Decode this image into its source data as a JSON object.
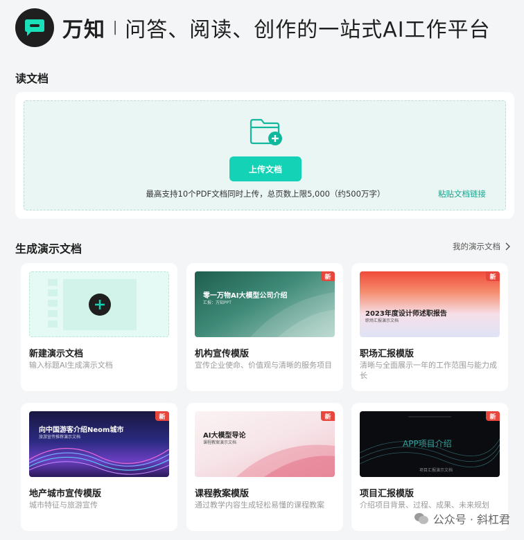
{
  "header": {
    "brand": "万知",
    "separator": "I",
    "slogan": "问答、阅读、创作的一站式AI工作平台"
  },
  "read_section": {
    "title": "读文档",
    "upload_button": "上传文档",
    "hint": "最高支持10个PDF文档同时上传，总页数上限5,000（约500万字）",
    "paste_link": "粘贴文档链接"
  },
  "present_section": {
    "title": "生成演示文档",
    "my_docs_link": "我的演示文档",
    "cards": [
      {
        "title": "新建演示文档",
        "desc": "输入标题AI生成演示文档"
      },
      {
        "title": "机构宣传模版",
        "desc": "宣传企业使命、价值观与清晰的服务项目",
        "badge": "新",
        "thumb_title": "零一万物AI大模型公司介绍",
        "thumb_sub": "汇报：万知PPT"
      },
      {
        "title": "职场汇报模版",
        "desc": "清晰与全面展示一年的工作范围与能力成长",
        "badge": "新",
        "thumb_title": "2023年度设计师述职报告",
        "thumb_sub": "职场汇报演示文档"
      },
      {
        "title": "地产城市宣传模版",
        "desc": "城市特征与旅游宣传",
        "badge": "新",
        "thumb_title": "向中国游客介绍Neom城市",
        "thumb_sub": "旅游宣传推荐演示文档"
      },
      {
        "title": "课程教案模版",
        "desc": "通过教学内容生成轻松易懂的课程教案",
        "badge": "新",
        "thumb_title": "AI大模型导论",
        "thumb_sub": "课程教案演示文档"
      },
      {
        "title": "项目汇报模版",
        "desc": "介绍项目背景、过程、成果、未来规划",
        "badge": "新",
        "thumb_title": "APP项目介绍",
        "thumb_sub": "项目汇报演示文档"
      }
    ]
  },
  "watermark": {
    "text": "公众号 · 斜杠君"
  },
  "colors": {
    "accent": "#14d2b5",
    "link": "#12a58f",
    "badge": "#e8463c",
    "page_bg": "#f4f5f6"
  }
}
